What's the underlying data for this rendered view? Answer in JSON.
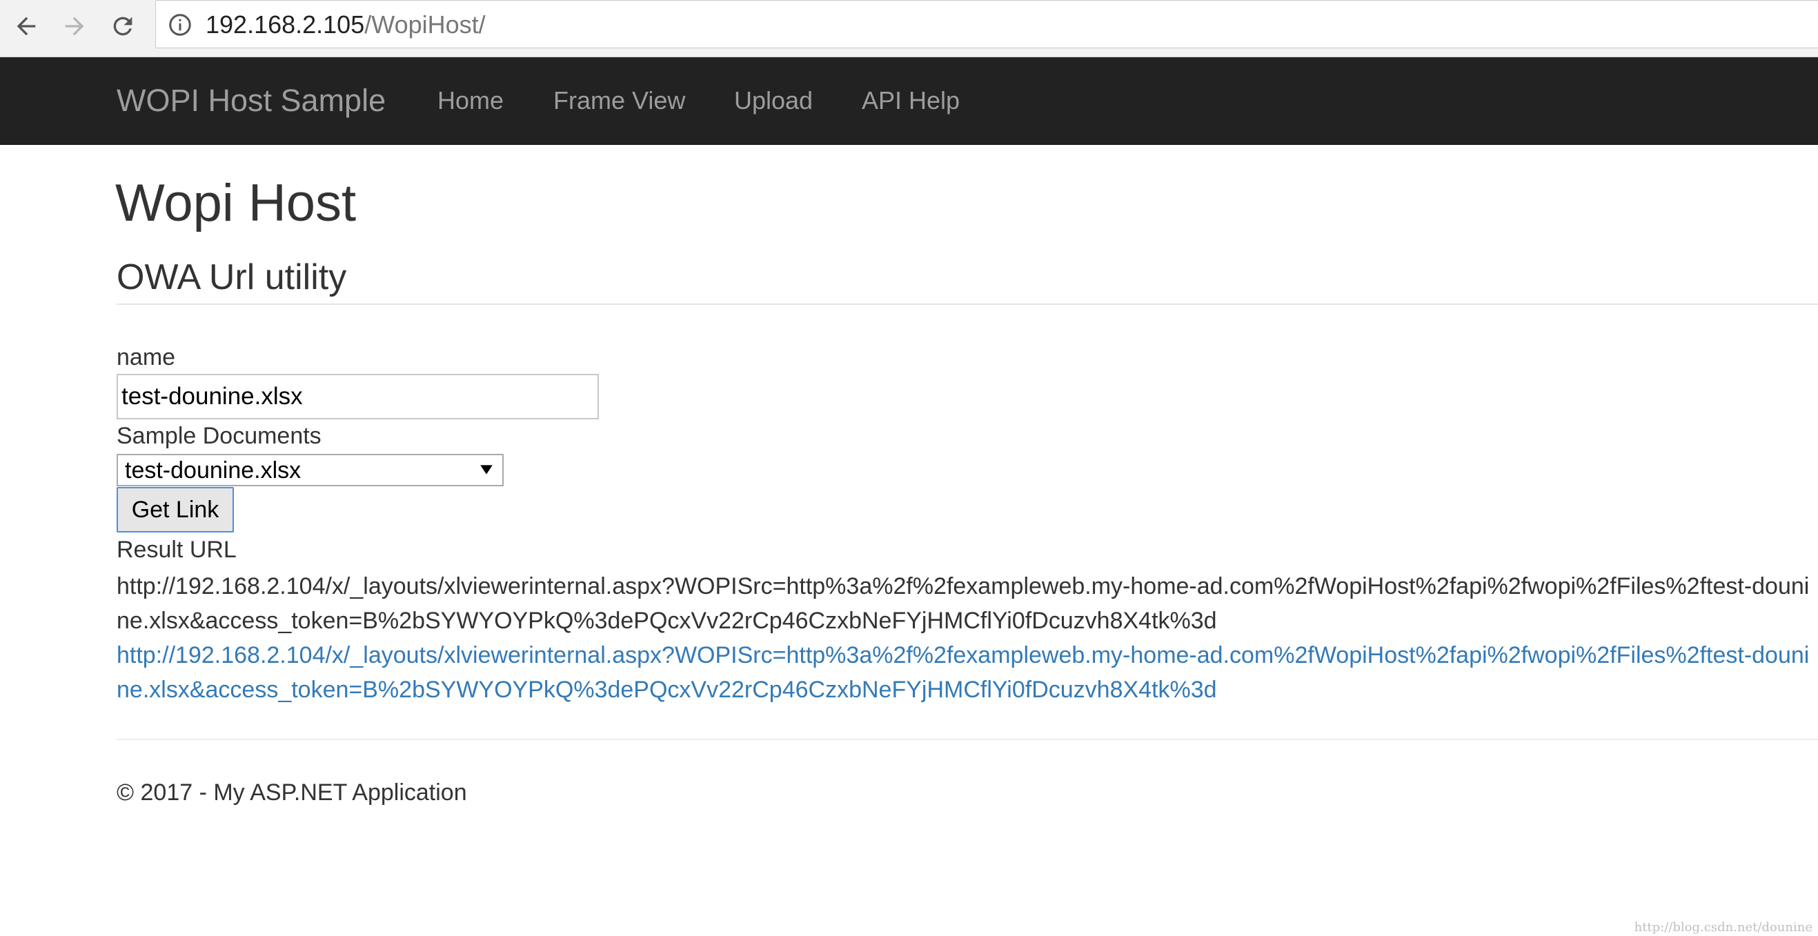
{
  "browser": {
    "url_host": "192.168.2.105",
    "url_path": "/WopiHost/",
    "icons": {
      "back": "arrow-left-icon",
      "forward": "arrow-right-icon",
      "reload": "reload-icon",
      "site_info": "info-circle-icon"
    }
  },
  "navbar": {
    "brand": "WOPI Host Sample",
    "links": [
      "Home",
      "Frame View",
      "Upload",
      "API Help"
    ]
  },
  "main": {
    "title": "Wopi Host",
    "subtitle": "OWA Url utility",
    "form": {
      "name_label": "name",
      "name_value": "test-dounine.xlsx",
      "sample_label": "Sample Documents",
      "sample_selected": "test-dounine.xlsx",
      "get_link_label": "Get Link"
    },
    "result": {
      "label": "Result URL",
      "url_text": "http://192.168.2.104/x/_layouts/xlviewerinternal.aspx?WOPISrc=http%3a%2f%2fexampleweb.my-home-ad.com%2fWopiHost%2fapi%2fwopi%2fFiles%2ftest-dounine.xlsx&access_token=B%2bSYWYOYPkQ%3dePQcxVv22rCp46CzxbNeFYjHMCflYi0fDcuzvh8X4tk%3d",
      "url_link": "http://192.168.2.104/x/_layouts/xlviewerinternal.aspx?WOPISrc=http%3a%2f%2fexampleweb.my-home-ad.com%2fWopiHost%2fapi%2fwopi%2fFiles%2ftest-dounine.xlsx&access_token=B%2bSYWYOYPkQ%3dePQcxVv22rCp46CzxbNeFYjHMCflYi0fDcuzvh8X4tk%3d"
    }
  },
  "footer": {
    "text": "© 2017 - My ASP.NET Application"
  },
  "watermark": "http://blog.csdn.net/dounine",
  "colors": {
    "navbar_bg": "#222222",
    "navbar_text": "#9d9d9d",
    "link": "#337ab7",
    "text": "#333333",
    "button_focus_border": "#4a90e2"
  }
}
